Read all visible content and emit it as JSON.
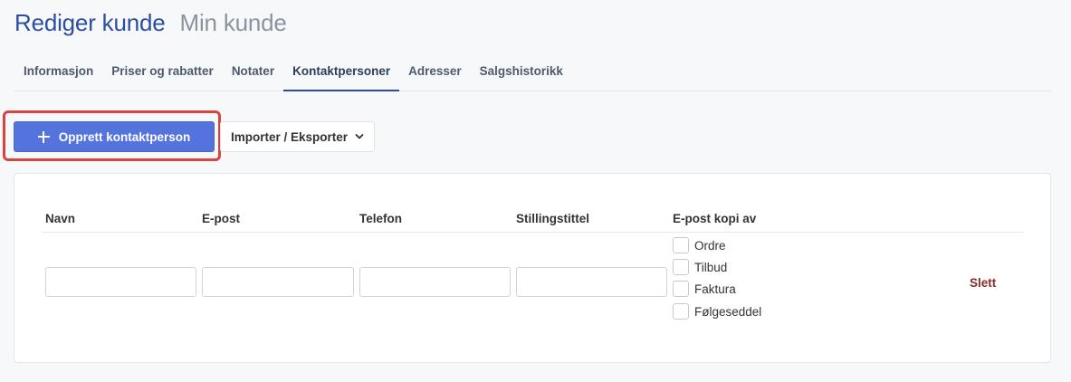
{
  "header": {
    "title": "Rediger kunde",
    "subtitle": "Min kunde"
  },
  "tabs": [
    {
      "label": "Informasjon",
      "active": false
    },
    {
      "label": "Priser og rabatter",
      "active": false
    },
    {
      "label": "Notater",
      "active": false
    },
    {
      "label": "Kontaktpersoner",
      "active": true
    },
    {
      "label": "Adresser",
      "active": false
    },
    {
      "label": "Salgshistorikk",
      "active": false
    }
  ],
  "toolbar": {
    "create_label": "Opprett kontaktperson",
    "create_icon": "plus-icon",
    "import_export_label": "Importer / Eksporter",
    "import_export_icon": "chevron-down-icon"
  },
  "table": {
    "headers": {
      "name": "Navn",
      "email": "E-post",
      "phone": "Telefon",
      "title": "Stillingstittel",
      "copy_of": "E-post kopi av"
    },
    "row": {
      "name": "",
      "email": "",
      "phone": "",
      "job_title": "",
      "copy_options": [
        {
          "label": "Ordre",
          "checked": false
        },
        {
          "label": "Tilbud",
          "checked": false
        },
        {
          "label": "Faktura",
          "checked": false
        },
        {
          "label": "Følgeseddel",
          "checked": false
        }
      ],
      "delete_label": "Slett"
    }
  },
  "colors": {
    "primary": "#5473dc",
    "title": "#2d4ea0",
    "highlight": "#d9443f",
    "danger": "#8a2a2a"
  }
}
